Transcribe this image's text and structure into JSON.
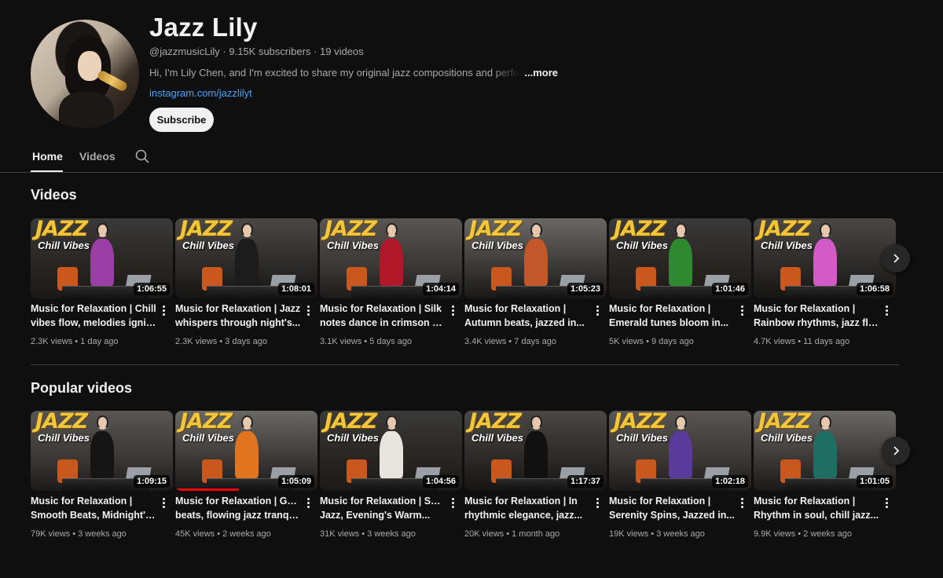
{
  "channel": {
    "name": "Jazz Lily",
    "handle": "@jazzmusicLily",
    "subscribers": "9.15K subscribers",
    "video_count": "19 videos",
    "description": "Hi, I'm Lily Chen, and I'm excited to share my original jazz compositions and performances",
    "more_label": "...more",
    "link": "instagram.com/jazzlilyt",
    "subscribe_label": "Subscribe"
  },
  "tabs": [
    {
      "label": "Home",
      "active": true
    },
    {
      "label": "Videos",
      "active": false
    }
  ],
  "thumbnail_text": {
    "headline": "JAZZ",
    "subline": "Chill Vibes"
  },
  "sections": [
    {
      "title": "Videos",
      "videos": [
        {
          "line1": "Music for Relaxation | Chill",
          "line2": "vibes flow, melodies ignite...",
          "duration": "1:06:55",
          "views": "2.3K views",
          "age": "1 day ago",
          "outfit": "#9b3fa6"
        },
        {
          "line1": "Music for Relaxation | Jazz",
          "line2": "whispers through night's...",
          "duration": "1:08:01",
          "views": "2.3K views",
          "age": "3 days ago",
          "outfit": "#1c1c1c"
        },
        {
          "line1": "Music for Relaxation | Silk",
          "line2": "notes dance in crimson allu...",
          "duration": "1:04:14",
          "views": "3.1K views",
          "age": "5 days ago",
          "outfit": "#b0182a"
        },
        {
          "line1": "Music for Relaxation |",
          "line2": "Autumn beats, jazzed in...",
          "duration": "1:05:23",
          "views": "3.4K views",
          "age": "7 days ago",
          "outfit": "#c2572a"
        },
        {
          "line1": "Music for Relaxation |",
          "line2": "Emerald tunes bloom in...",
          "duration": "1:01:46",
          "views": "5K views",
          "age": "9 days ago",
          "outfit": "#2f8a2f"
        },
        {
          "line1": "Music for Relaxation |",
          "line2": "Rainbow rhythms, jazz flow...",
          "duration": "1:06:58",
          "views": "4.7K views",
          "age": "11 days ago",
          "outfit": "#d35ac7"
        }
      ]
    },
    {
      "title": "Popular videos",
      "videos": [
        {
          "line1": "Music for Relaxation |",
          "line2": "Smooth Beats, Midnight's...",
          "duration": "1:09:15",
          "views": "79K views",
          "age": "3 weeks ago",
          "outfit": "#151515"
        },
        {
          "line1": "Music for Relaxation | Golden",
          "line2": "beats, flowing jazz tranquilit...",
          "duration": "1:05:09",
          "views": "45K views",
          "age": "2 weeks ago",
          "outfit": "#e0741f",
          "watched": 0.45
        },
        {
          "line1": "Music for Relaxation | Soulful",
          "line2": "Jazz, Evening's Warm...",
          "duration": "1:04:56",
          "views": "31K views",
          "age": "3 weeks ago",
          "outfit": "#e8e4de"
        },
        {
          "line1": "Music for Relaxation | In",
          "line2": "rhythmic elegance, jazz...",
          "duration": "1:17:37",
          "views": "20K views",
          "age": "1 month ago",
          "outfit": "#111111"
        },
        {
          "line1": "Music for Relaxation |",
          "line2": "Serenity Spins, Jazzed in...",
          "duration": "1:02:18",
          "views": "19K views",
          "age": "3 weeks ago",
          "outfit": "#5a3a9a"
        },
        {
          "line1": "Music for Relaxation |",
          "line2": "Rhythm in soul, chill jazz...",
          "duration": "1:01:05",
          "views": "9.9K views",
          "age": "2 weeks ago",
          "outfit": "#1f6e63"
        }
      ]
    }
  ]
}
